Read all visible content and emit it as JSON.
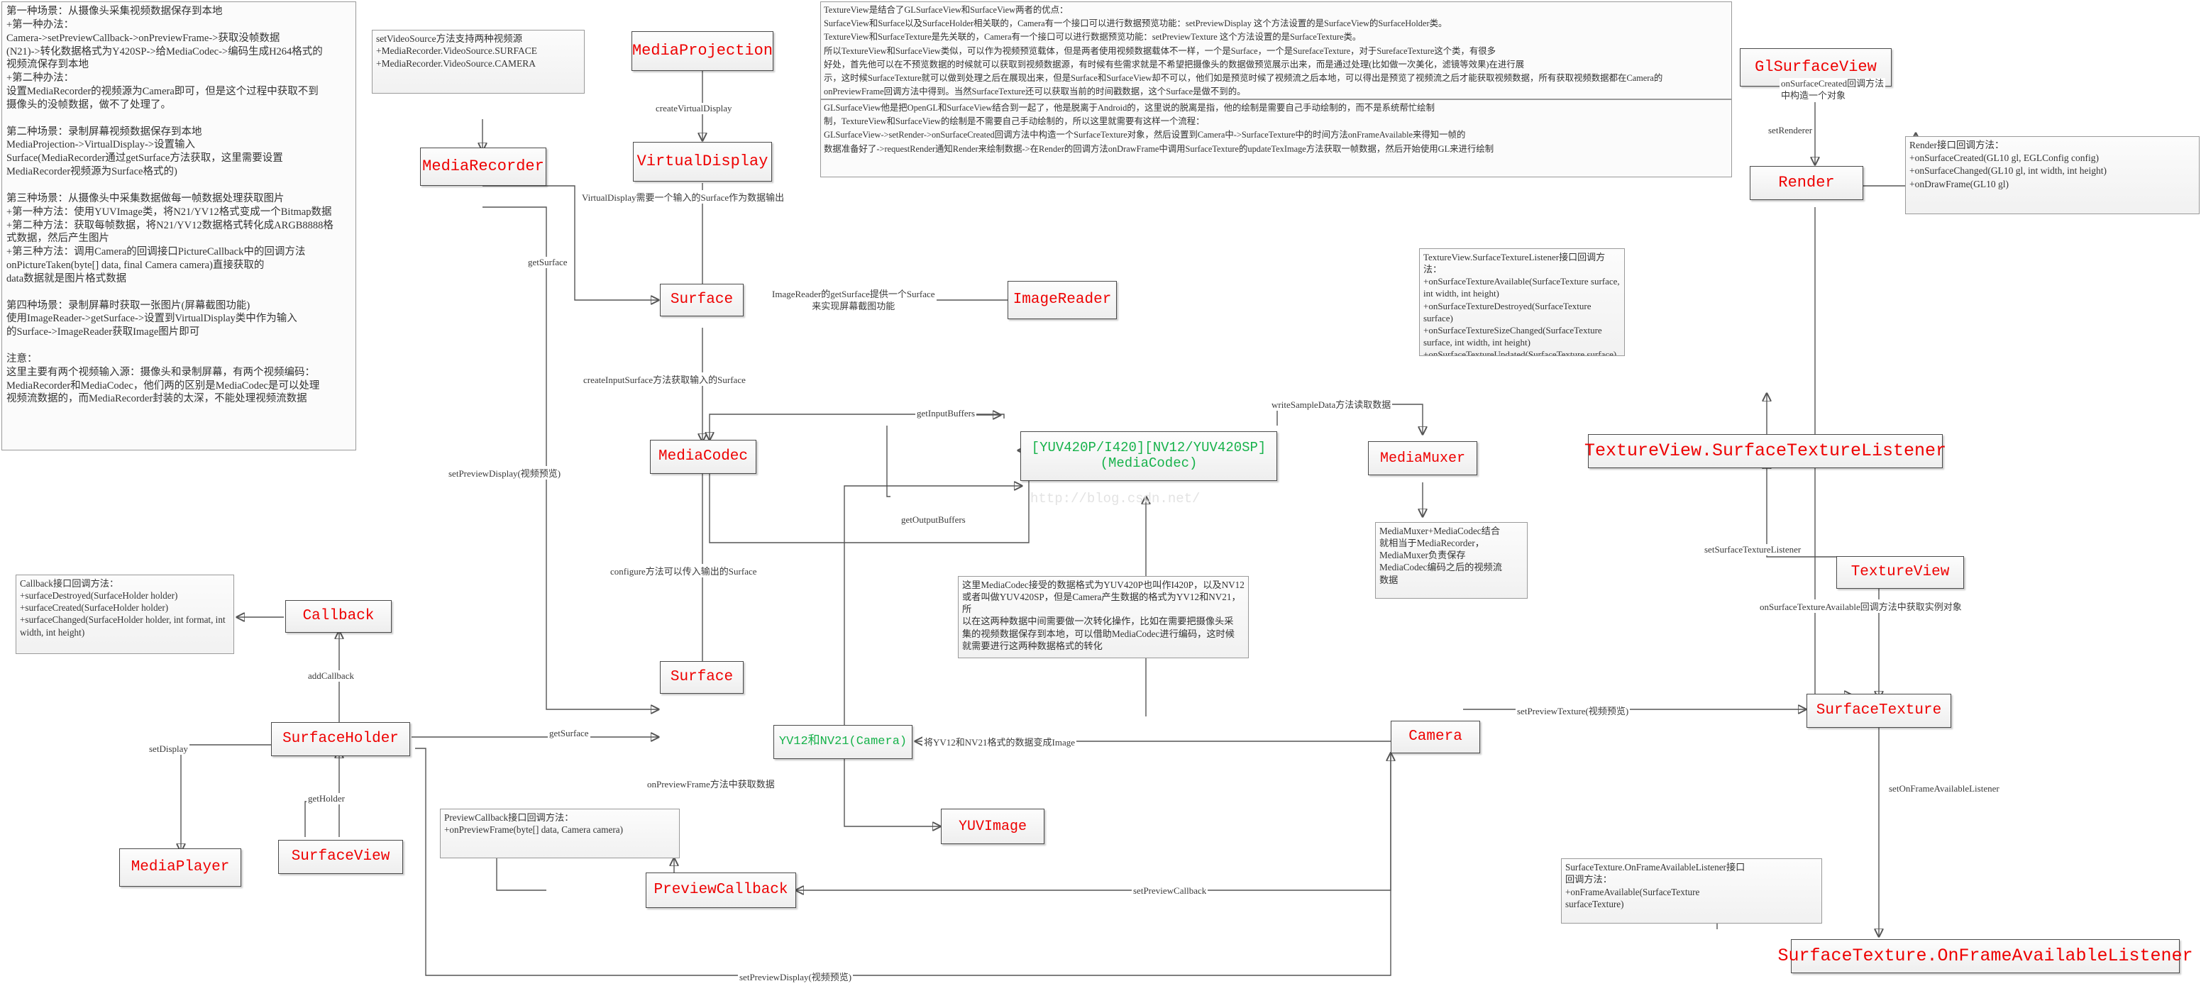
{
  "notes": {
    "scenarios": "第一种场景：从摄像头采集视频数据保存到本地\n+第一种办法：\nCamera->setPreviewCallback->onPreviewFrame->获取没帧数据\n(N21)->转化数据格式为Y420SP->给MediaCodec->编码生成H264格式的\n视频流保存到本地\n+第二种办法：\n设置MediaRecorder的视频源为Camera即可，但是这个过程中获取不到\n摄像头的没帧数据，做不了处理了。\n\n第二种场景：录制屏幕视频数据保存到本地\nMediaProjection->VirtualDisplay->设置输入\nSurface(MediaRecorder通过getSurface方法获取，这里需要设置\nMediaRecorder视频源为Surface格式的)\n\n第三种场景：从摄像头中采集数据做每一帧数据处理获取图片\n+第一种方法：使用YUVImage类，将N21/YV12格式变成一个Bitmap数据\n+第二种方法：获取每帧数据，将N21/YV12数据格式转化成ARGB8888格\n式数据，然后产生图片\n+第三种方法：调用Camera的回调接口PictureCallback中的回调方法\nonPictureTaken(byte[] data, final Camera camera)直接获取的\ndata数据就是图片格式数据\n\n第四种场景：录制屏幕时获取一张图片(屏幕截图功能)\n使用ImageReader->getSurface->设置到VirtualDisplay类中作为输入\n的Surface->ImageReader获取Image图片即可\n\n注意：\n这里主要有两个视频输入源：摄像头和录制屏幕，有两个视频编码：\nMediaRecorder和MediaCodec，他们两的区别是MediaCodec是可以处理\n视频流数据的，而MediaRecorder封装的太深，不能处理视频流数据",
    "set_video_source": "setVideoSource方法支持两种视频源\n+MediaRecorder.VideoSource.SURFACE\n+MediaRecorder.VideoSource.CAMERA",
    "textureview_long": "TextureView是结合了GLSurfaceView和SurfaceView两者的优点：\nSurfaceView和Surface以及SurfaceHolder相关联的，Camera有一个接口可以进行数据预览功能：setPreviewDisplay 这个方法设置的是SurfaceView的SurfaceHolder类。\nTextureView和SurfaceTexture是先关联的，Camera有一个接口可以进行数据预览功能：setPreviewTexture 这个方法设置的是SurfaceTexture类。\n所以TextureView和SurfaceView类似，可以作为视频预览载体，但是两者使用视频数据载体不一样，一个是Surface，一个是SurefaceTexture，对于SurefaceTexture这个类，有很多\n好处，首先他可以在不预览数据的时候就可以获取到视频数据源，有时候有些需求就是不希望把摄像头的数据做预览展示出来，而是通过处理(比如做一次美化，滤镜等效果)在进行展\n示，这时候SurfaceTexture就可以做到处理之后在展现出来，但是Surface和SurfaceView却不可以，他们如是预览时候了视频流之后本地，可以得出是预览了视频流之后才能获取视频数据，所有获取视频数据都在Camera的\nonPreviewFrame回调方法中得到。当然SurfaceTexture还可以获取当前的时间戳数据，这个Surface是做不到的。",
    "glsurfaceview_long": "GLSurfaceView他是把OpenGL和SurfaceView结合到一起了，他是脱离于Android的，这里说的脱离是指，他的绘制是需要自己手动绘制的，而不是系统帮忙绘制\n制，TextureView和SurfaceView的绘制是不需要自己手动绘制的，所以这里就需要有这样一个流程：\nGLSurfaceView->setRender->onSurfaceCreated回调方法中构造一个SurfaceTexture对象，然后设置到Camera中->SurfaceTexture中的时间方法onFrameAvailable来得知一帧的\n数据准备好了->requestRender通知Render来绘制数据->在Render的回调方法onDrawFrame中调用SurfaceTexture的updateTexImage方法获取一帧数据，然后开始使用GL来进行绘制",
    "render_callbacks": "Render接口回调方法：\n+onSurfaceCreated(GL10 gl, EGLConfig config)\n+onSurfaceChanged(GL10 gl, int width, int height)\n+onDrawFrame(GL10 gl)",
    "texture_listener": "TextureView.SurfaceTextureListener接口回调方法：\n+onSurfaceTextureAvailable(SurfaceTexture surface, int width, int height)\n+onSurfaceTextureDestroyed(SurfaceTexture surface)\n+onSurfaceTextureSizeChanged(SurfaceTexture surface, int width, int height)\n+onSurfaceTextureUpdated(SurfaceTexture surface)",
    "callback_iface": "Callback接口回调方法：\n+surfaceDestroyed(SurfaceHolder holder)\n+surfaceCreated(SurfaceHolder holder)\n+surfaceChanged(SurfaceHolder holder, int format, int width, int height)",
    "preview_callback_iface": "PreviewCallback接口回调方法：\n+onPreviewFrame(byte[] data, Camera camera)",
    "mediamuxer_note": "MediaMuxer+MediaCodec结合\n就相当于MediaRecorder，\nMediaMuxer负责保存\nMediaCodec编码之后的视频流\n数据",
    "mediacodec_format_note": "这里MediaCodec接受的数据格式为YUV420P也叫作I420P，以及NV12\n或者叫做YUV420SP，但是Camera产生数据的格式为YV12和NV21，所\n以在这两种数据中间需要做一次转化操作，比如在需要把摄像头采\n集的视频数据保存到本地，可以借助MediaCodec进行编码，这时候\n就需要进行这两种数据格式的转化",
    "onframe_listener": "SurfaceTexture.OnFrameAvailableListener接口\n回调方法：\n+onFrameAvailable(SurfaceTexture\nsurfaceTexture)"
  },
  "nodes": {
    "media_projection": "MediaProjection",
    "media_recorder": "MediaRecorder",
    "virtual_display": "VirtualDisplay",
    "surface_top": "Surface",
    "image_reader": "ImageReader",
    "media_codec": "MediaCodec",
    "yuv_box": "[YUV420P/I420][NV12/YUV420SP]\n(MediaCodec)",
    "media_muxer": "MediaMuxer",
    "callback": "Callback",
    "surface_bottom": "Surface",
    "surface_holder": "SurfaceHolder",
    "yv12_nv21": "YV12和NV21(Camera)",
    "camera": "Camera",
    "media_player": "MediaPlayer",
    "surface_view": "SurfaceView",
    "yuv_image": "YUVImage",
    "preview_callback": "PreviewCallback",
    "gl_surface_view": "GlSurfaceView",
    "render": "Render",
    "texture_view_listener": "TextureView.SurfaceTextureListener",
    "texture_view": "TextureView",
    "surface_texture": "SurfaceTexture",
    "on_frame_listener": "SurfaceTexture.OnFrameAvailableListener"
  },
  "edge_labels": {
    "create_virtual_display": "createVirtualDisplay",
    "virtual_display_need": "VirtualDisplay需要一个输入的Surface作为数据输出",
    "get_surface": "getSurface",
    "image_reader_surface": "ImageReader的getSurface提供一个Surface\n来实现屏幕截图功能",
    "create_input_surface": "createInputSurface方法获取输入的Surface",
    "set_preview_display_top": "setPreviewDisplay(视频预览)",
    "get_input_buffers": "getInputBuffers",
    "get_output_buffers": "getOutputBuffers",
    "write_sample_data": "writeSampleData方法读取数据",
    "configure": "configure方法可以传入输出的Surface",
    "add_callback": "addCallback",
    "get_surface2": "getSurface",
    "set_display": "setDisplay",
    "get_holder": "getHolder",
    "to_image": "将YV12和NV21格式的数据变成Image",
    "on_preview_frame": "onPreviewFrame方法中获取数据",
    "set_preview_callback": "setPreviewCallback",
    "set_preview_display_bottom": "setPreviewDisplay(视频预览)",
    "set_renderer": "setRenderer",
    "set_surface_texture_listener": "setSurfaceTextureListener",
    "on_surface_texture_available": "onSurfaceTextureAvailable回调方法中获取实例对象",
    "on_surface_created": "onSurfaceCreated回调方法\n中构造一个对象",
    "set_preview_texture": "setPreviewTexture(视频预览)",
    "set_on_frame_available_listener": "setOnFrameAvailableListener"
  },
  "watermark": "http://blog.csdn.net/"
}
